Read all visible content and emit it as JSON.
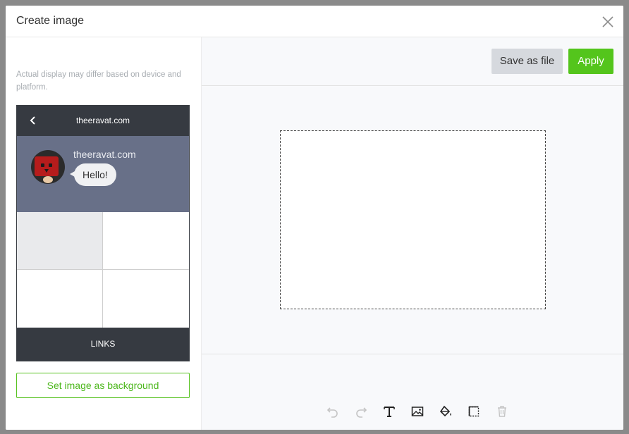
{
  "dialog": {
    "title": "Create image"
  },
  "left": {
    "note": "Actual display may differ based on device and platform.",
    "preview": {
      "header_title": "theeravat.com",
      "chat_name": "theeravat.com",
      "bubble_text": "Hello!",
      "footer_label": "LINKS"
    },
    "bg_button": "Set image as background"
  },
  "right": {
    "save_label": "Save as file",
    "apply_label": "Apply"
  },
  "tools": [
    "undo-icon",
    "redo-icon",
    "text-icon",
    "image-icon",
    "fill-icon",
    "crop-icon",
    "trash-icon"
  ],
  "colors": {
    "accent": "#54c51c",
    "phone_dark": "#363a41",
    "chat_bg": "#687088"
  }
}
